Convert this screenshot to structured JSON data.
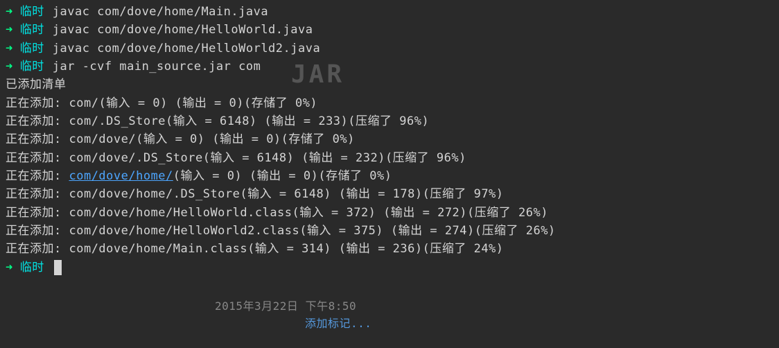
{
  "prompt": {
    "arrow": "➜",
    "dir": "临时"
  },
  "commands": [
    "javac com/dove/home/Main.java",
    "javac com/dove/home/HelloWorld.java",
    "javac com/dove/home/HelloWorld2.java",
    "jar -cvf main_source.jar com"
  ],
  "manifest_line": "已添加清单",
  "output_lines": [
    {
      "prefix": "正在添加: ",
      "path": "com/",
      "rest": "(输入 = 0) (输出 = 0)(存储了 0%)",
      "link": false
    },
    {
      "prefix": "正在添加: ",
      "path": "com/.DS_Store",
      "rest": "(输入 = 6148) (输出 = 233)(压缩了 96%)",
      "link": false
    },
    {
      "prefix": "正在添加: ",
      "path": "com/dove/",
      "rest": "(输入 = 0) (输出 = 0)(存储了 0%)",
      "link": false
    },
    {
      "prefix": "正在添加: ",
      "path": "com/dove/.DS_Store",
      "rest": "(输入 = 6148) (输出 = 232)(压缩了 96%)",
      "link": false
    },
    {
      "prefix": "正在添加: ",
      "path": "com/dove/home/",
      "rest": "(输入 = 0) (输出 = 0)(存储了 0%)",
      "link": true
    },
    {
      "prefix": "正在添加: ",
      "path": "com/dove/home/.DS_Store",
      "rest": "(输入 = 6148) (输出 = 178)(压缩了 97%)",
      "link": false
    },
    {
      "prefix": "正在添加: ",
      "path": "com/dove/home/HelloWorld.class",
      "rest": "(输入 = 372) (输出 = 272)(压缩了 26%)",
      "link": false
    },
    {
      "prefix": "正在添加: ",
      "path": "com/dove/home/HelloWorld2.class",
      "rest": "(输入 = 375) (输出 = 274)(压缩了 26%)",
      "link": false
    },
    {
      "prefix": "正在添加: ",
      "path": "com/dove/home/Main.class",
      "rest": "(输入 = 314) (输出 = 236)(压缩了 24%)",
      "link": false
    }
  ],
  "bg": {
    "jar": "JAR",
    "timestamp": "2015年3月22日 下午8:50",
    "add_tag": "添加标记..."
  }
}
